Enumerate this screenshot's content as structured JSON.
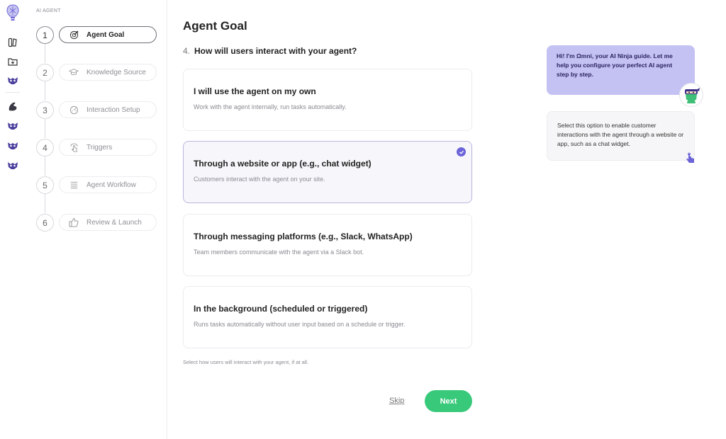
{
  "sidebar": {
    "title": "AI AGENT",
    "steps": [
      {
        "num": "1",
        "label": "Agent Goal",
        "icon": "target-icon",
        "active": true
      },
      {
        "num": "2",
        "label": "Knowledge Source",
        "icon": "graduation-cap-icon",
        "active": false
      },
      {
        "num": "3",
        "label": "Interaction Setup",
        "icon": "dashboard-icon",
        "active": false
      },
      {
        "num": "4",
        "label": "Triggers",
        "icon": "touch-icon",
        "active": false
      },
      {
        "num": "5",
        "label": "Agent Workflow",
        "icon": "list-icon",
        "active": false
      },
      {
        "num": "6",
        "label": "Review & Launch",
        "icon": "thumbs-up-icon",
        "active": false
      }
    ]
  },
  "main": {
    "title": "Agent Goal",
    "question_number": "4.",
    "question": "How will users interact with your agent?",
    "options": [
      {
        "title": "I will use the agent on my own",
        "description": "Work with the agent internally, run tasks automatically.",
        "selected": false
      },
      {
        "title": "Through a website or app (e.g., chat widget)",
        "description": "Customers interact with the agent on your site.",
        "selected": true
      },
      {
        "title": "Through messaging platforms (e.g., Slack, WhatsApp)",
        "description": "Team members communicate with the agent via a Slack bot.",
        "selected": false
      },
      {
        "title": "In the background (scheduled or triggered)",
        "description": "Runs tasks automatically without user input based on a schedule or trigger.",
        "selected": false
      }
    ],
    "hint": "Select how users will interact with your agent, if at all.",
    "skip_label": "Skip",
    "next_label": "Next"
  },
  "guide": {
    "greeting": "Hi! I'm Ωmni, your AI Ninja guide. Let me help you configure your perfect AI agent step by step.",
    "tip": "Select this option to enable customer interactions with the agent through a website or app, such as a chat widget."
  },
  "colors": {
    "accent": "#6c63d9",
    "next_button": "#38c97a",
    "guide_bubble": "#c4c1f3"
  }
}
